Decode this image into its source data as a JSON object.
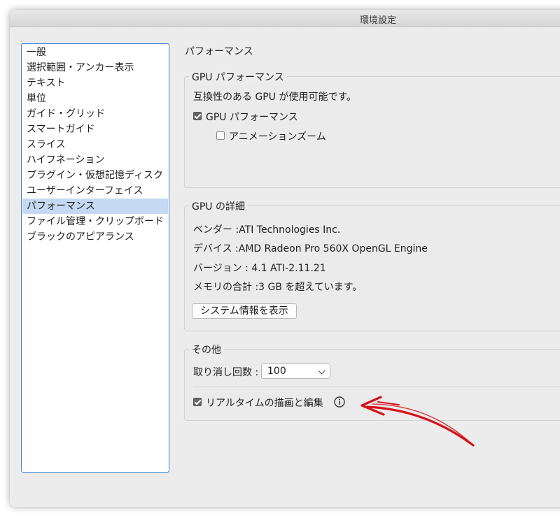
{
  "window": {
    "title": "環境設定"
  },
  "sidebar": {
    "items": [
      {
        "label": "一般"
      },
      {
        "label": "選択範囲・アンカー表示"
      },
      {
        "label": "テキスト"
      },
      {
        "label": "単位"
      },
      {
        "label": "ガイド・グリッド"
      },
      {
        "label": "スマートガイド"
      },
      {
        "label": "スライス"
      },
      {
        "label": "ハイフネーション"
      },
      {
        "label": "プラグイン・仮想記憶ディスク"
      },
      {
        "label": "ユーザーインターフェイス"
      },
      {
        "label": "パフォーマンス"
      },
      {
        "label": "ファイル管理・クリップボード"
      },
      {
        "label": "ブラックのアピアランス"
      }
    ],
    "selected_index": 10
  },
  "main": {
    "section_title": "パフォーマンス",
    "gpu_performance": {
      "group_label": "GPU パフォーマンス",
      "compat_text": "互換性のある GPU が使用可能です。",
      "gpu_checkbox_label": "GPU パフォーマンス",
      "gpu_checked": true,
      "animation_zoom_label": "アニメーションズーム",
      "animation_zoom_checked": false
    },
    "gpu_details": {
      "group_label": "GPU の詳細",
      "vendor": "ベンダー :ATI Technologies Inc.",
      "device": "デバイス :AMD Radeon Pro 560X OpenGL Engine",
      "version": "バージョン : 4.1 ATI-2.11.21",
      "memory": "メモリの合計 :3 GB を超えています。",
      "system_info_button": "システム情報を表示"
    },
    "other": {
      "group_label": "その他",
      "undo_label": "取り消し回数 :",
      "undo_value": "100",
      "realtime_label": "リアルタイムの描画と編集",
      "realtime_checked": true
    }
  },
  "colors": {
    "selection": "#c6d9f2",
    "focus_border": "#3d84d6",
    "annotation_arrow": "#d4121a"
  },
  "icons": [
    "info-icon",
    "checkmark-icon",
    "chevron-down-icon"
  ]
}
